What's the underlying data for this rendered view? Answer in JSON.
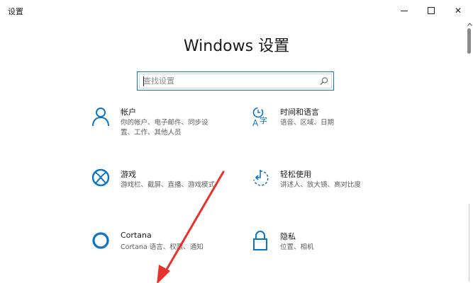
{
  "window": {
    "title": "设置",
    "controls": {
      "minimize": "minimize",
      "maximize": "maximize",
      "close": "✕"
    }
  },
  "heading": "Windows 设置",
  "search": {
    "placeholder": "查找设置"
  },
  "tiles": [
    {
      "title": "帐户",
      "desc_line1": "你的帐户、电子邮件、同步设",
      "desc_line2": "置、工作、其他人员",
      "icon": "person-icon"
    },
    {
      "title": "时间和语言",
      "desc_line1": "语音、区域、日期",
      "desc_line2": "",
      "icon": "time-language-icon"
    },
    {
      "title": "游戏",
      "desc_line1": "游戏栏、截屏、直播、游戏模式",
      "desc_line2": "",
      "icon": "xbox-icon"
    },
    {
      "title": "轻松使用",
      "desc_line1": "讲述人、放大镜、高对比度",
      "desc_line2": "",
      "icon": "ease-of-access-icon"
    },
    {
      "title": "Cortana",
      "desc_line1": "Cortana 语言、权限、通知",
      "desc_line2": "",
      "icon": "cortana-icon"
    },
    {
      "title": "隐私",
      "desc_line1": "位置、相机",
      "desc_line2": "",
      "icon": "lock-icon"
    }
  ],
  "colors": {
    "accent": "#0a74c8",
    "annotation": "#e8322b"
  }
}
